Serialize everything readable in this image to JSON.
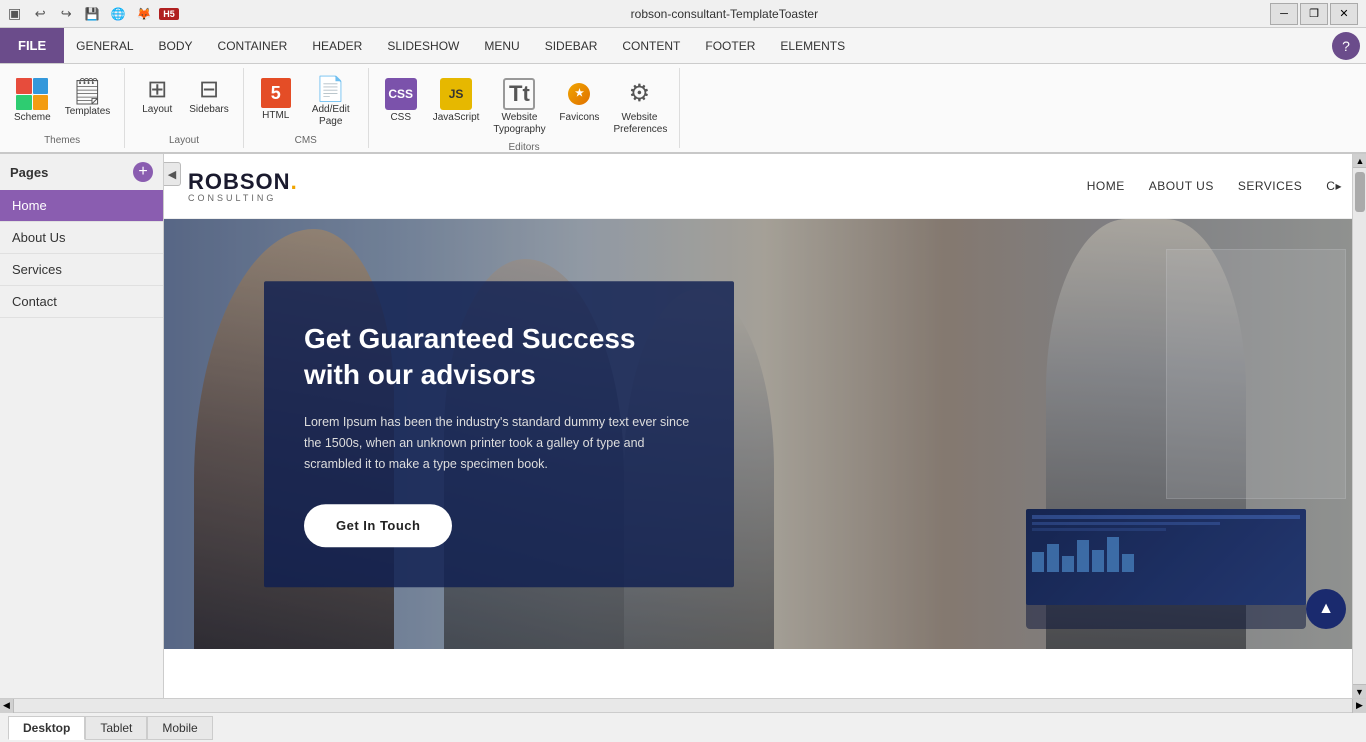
{
  "window": {
    "title": "robson-consultant-TemplateToaster",
    "controls": {
      "minimize": "─",
      "maximize": "❐",
      "close": "✕"
    }
  },
  "menubar": {
    "file": "FILE",
    "items": [
      "GENERAL",
      "BODY",
      "CONTAINER",
      "HEADER",
      "SLIDESHOW",
      "MENU",
      "SIDEBAR",
      "CONTENT",
      "FOOTER",
      "ELEMENTS"
    ]
  },
  "ribbon": {
    "groups": [
      {
        "label": "Themes",
        "items": [
          {
            "id": "scheme",
            "label": "Scheme"
          },
          {
            "id": "templates",
            "label": "Templates"
          }
        ]
      },
      {
        "label": "Layout",
        "items": [
          {
            "id": "layout",
            "label": "Layout"
          },
          {
            "id": "sidebars",
            "label": "Sidebars"
          }
        ]
      },
      {
        "label": "CMS",
        "items": [
          {
            "id": "html",
            "label": "HTML"
          },
          {
            "id": "addedit",
            "label": "Add/Edit\nPage"
          }
        ]
      },
      {
        "label": "Editors",
        "items": [
          {
            "id": "css",
            "label": "CSS"
          },
          {
            "id": "javascript",
            "label": "JavaScript"
          },
          {
            "id": "websitetypo",
            "label": "Website\nTypography"
          },
          {
            "id": "favicons",
            "label": "Favicons"
          },
          {
            "id": "websitepref",
            "label": "Website\nPreferences"
          }
        ]
      }
    ]
  },
  "pages": {
    "header": "Pages",
    "add_label": "+",
    "items": [
      {
        "id": "home",
        "label": "Home",
        "active": true
      },
      {
        "id": "about",
        "label": "About Us"
      },
      {
        "id": "services",
        "label": "Services"
      },
      {
        "id": "contact",
        "label": "Contact"
      }
    ]
  },
  "preview": {
    "logo": {
      "name": "ROBSON.",
      "tagline": "CONSULTING"
    },
    "nav_links": [
      "HOME",
      "ABOUT US",
      "SERVICES",
      "C"
    ],
    "hero": {
      "title": "Get Guaranteed Success\nwith our advisors",
      "body": "Lorem Ipsum has been the industry's standard dummy text ever since the 1500s, when an unknown printer took a galley of type and scrambled it to make a type specimen book.",
      "button": "Get In Touch"
    }
  },
  "bottom_tabs": [
    "Desktop",
    "Tablet",
    "Mobile"
  ],
  "toolbar_icons": {
    "undo": "↩",
    "redo": "↪",
    "save": "💾",
    "preview": "👁",
    "firefox": "🦊",
    "h5": "H5"
  }
}
